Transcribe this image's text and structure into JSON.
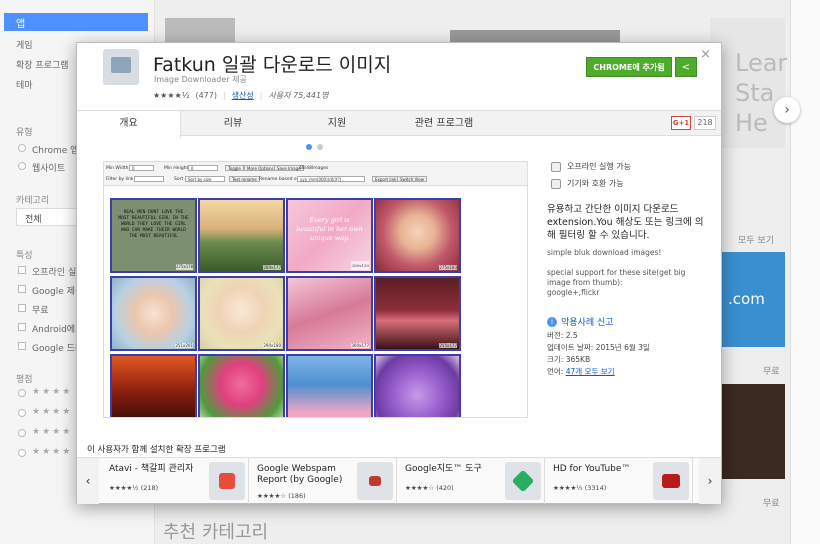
{
  "sidebar": {
    "selected": "앱",
    "categories": [
      "게임",
      "확장 프로그램",
      "테마"
    ],
    "type_heading": "유형",
    "types": [
      "Chrome 앱",
      "웹사이트"
    ],
    "category_heading": "카테고리",
    "category_value": "전체",
    "feature_heading": "특성",
    "features": [
      "오프라인 실행",
      "Google 제공",
      "무료",
      "Android에서",
      "Google 드라이브"
    ],
    "rating_heading": "평점"
  },
  "background": {
    "more_link_1": "모두 보기",
    "free_1": "무료",
    "free_2": "무료",
    "bottom_heading": "추천 카테고리",
    "tile_text": "Lear Sta He",
    "tile_com": ".com"
  },
  "dialog": {
    "title": "Fatkun 일괄 다운로드 이미지",
    "subtitle": "Image Downloader 제공",
    "rating_count": "(477)",
    "rating_stars": "★★★★½",
    "category_link": "생산성",
    "users": "사용자 75,441명",
    "add_button": "CHROME에 추가됨",
    "close": "×",
    "tabs": [
      "개요",
      "리뷰",
      "지원",
      "관련 프로그램"
    ],
    "gplus_label": "G+1",
    "gplus_count": "218",
    "features": [
      "오프라인 실행 가능",
      "기기와 호환 가능"
    ],
    "description_title": "유용하고 간단한 이미지 다운로드 extension.You 해상도 또는 링크에 의해 필터링 할 수 있습니다.",
    "description_1": "simple bluk download images!",
    "description_2": "special support for these site(get big image from thumb):",
    "description_3": "google+,flickr",
    "report": "악용사례 신고",
    "version": "버전: 2.5",
    "updated": "업데이트 날짜: 2015년 6월 3일",
    "size": "크기: 365KB",
    "language_prefix": "언어: ",
    "language_link": "47개 모두 보기",
    "related_title": "이 사용자가 함께 설치한 확장 프로그램",
    "related": [
      {
        "name": "Atavi - 책갈피 관리자",
        "stars": "★★★★½",
        "count": "(218)",
        "color": "#e74c3c"
      },
      {
        "name": "Google Webspam Report (by Google)",
        "stars": "★★★★☆",
        "count": "(186)",
        "color": "#c0392b"
      },
      {
        "name": "Google지도™ 도구",
        "stars": "★★★★☆",
        "count": "(420)",
        "color": "#27ae60"
      },
      {
        "name": "HD for YouTube™",
        "stars": "★★★★½",
        "count": "(3314)",
        "color": "#b71c1c"
      }
    ]
  },
  "screenshot": {
    "toolbar": {
      "min_width": "Min Width",
      "min_width_val": "0",
      "min_height": "Min Height",
      "min_height_val": "0",
      "toggle": "Toggle",
      "more_options": "More Options",
      "save_image": "Save Image",
      "images_count": "48/48Images",
      "filter_link": "Filter by link",
      "sort": "Sort",
      "sort_by": "Sort by size",
      "text_rename": "Text rename",
      "rename_based": "Rename based on",
      "rename_pattern": "yyy_mm(000)(d)(X?)",
      "export_link": "Export link",
      "switch_view": "Switch View"
    },
    "thumb_text": "REAL MEN DONT LOVE THE MOST BEAUTIFUL GIRL IN THE WORLD THEY LOVE THE GIRL WHO CAN MAKE THEIR WORLD THE MOST BEAUTIFUL",
    "thumb_pink_text": "Every girl is beautiful in her own unique way.",
    "sizes": [
      "275x170",
      "289x177",
      "200x130",
      "275x183",
      "251x201",
      "290x180",
      "300x177",
      "255x177"
    ]
  },
  "colors": {
    "accent": "#4d90fe",
    "add_green": "#4eab2c",
    "thumb_border": "#3e3ea8"
  }
}
